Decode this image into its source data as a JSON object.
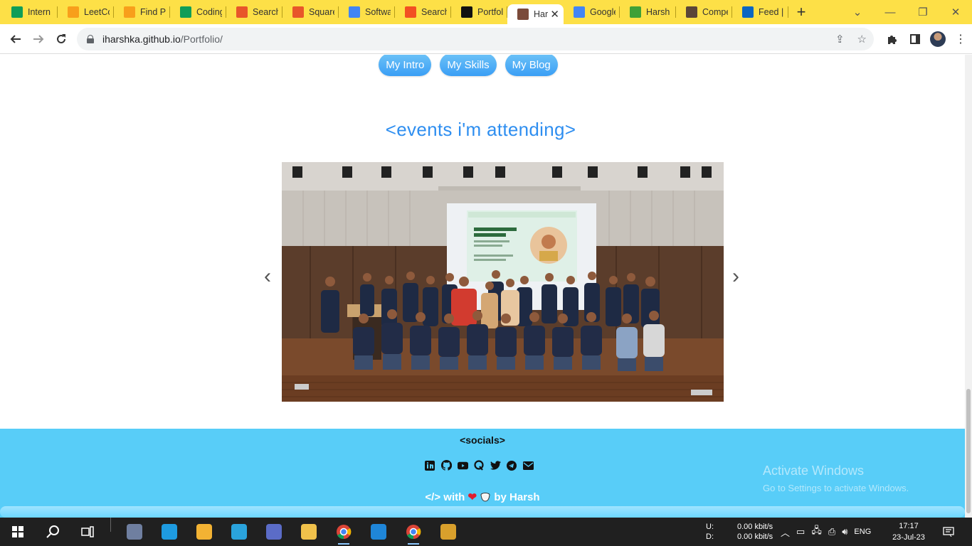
{
  "tabs": [
    {
      "title": "Intern",
      "icon": "sheets-icon",
      "color": "#0f9d58"
    },
    {
      "title": "LeetCo",
      "icon": "leetcode-icon",
      "color": "#f89f1b"
    },
    {
      "title": "Find Pi",
      "icon": "leetcode-icon",
      "color": "#f89f1b"
    },
    {
      "title": "Coding",
      "icon": "sheets-icon",
      "color": "#0f9d58"
    },
    {
      "title": "Search",
      "icon": "codechef-icon",
      "color": "#e8562a"
    },
    {
      "title": "Square",
      "icon": "codechef-icon",
      "color": "#e8562a"
    },
    {
      "title": "Softwa",
      "icon": "google-icon",
      "color": "#4285f4"
    },
    {
      "title": "Search",
      "icon": "microsoft-icon",
      "color": "#f25022"
    },
    {
      "title": "Portfol",
      "icon": "github-icon",
      "color": "#111111"
    },
    {
      "title": "Har",
      "icon": "profile-photo-icon",
      "color": "#7b4a3a"
    },
    {
      "title": "Google",
      "icon": "docs-icon",
      "color": "#4285f4"
    },
    {
      "title": "Harsh",
      "icon": "mongodb-leaf-icon",
      "color": "#3fa037"
    },
    {
      "title": "Compe",
      "icon": "cc-icon",
      "color": "#5b4638"
    },
    {
      "title": "Feed |",
      "icon": "linkedin-icon",
      "color": "#0a66c2"
    }
  ],
  "active_tab_index": 9,
  "address": {
    "host": "iharshka.github.io",
    "path": "/Portfolio/"
  },
  "nav": {
    "buttons": [
      "My Intro",
      "My Skills",
      "My Blog"
    ]
  },
  "events": {
    "heading": "<events i'm attending>",
    "prev_label": "‹",
    "next_label": "›"
  },
  "footer": {
    "socials_title": "<socials>",
    "social_icons": [
      "linkedin-icon",
      "github-icon",
      "youtube-icon",
      "quora-icon",
      "twitter-icon",
      "telegram-icon",
      "email-icon"
    ],
    "credit_prefix": "</> with",
    "credit_suffix": "by Harsh"
  },
  "watermark": {
    "line1": "Activate Windows",
    "line2": "Go to Settings to activate Windows."
  },
  "taskbar": {
    "apps": [
      "start-icon",
      "search-icon",
      "task-view-icon",
      "calculator-icon",
      "edge-icon",
      "store-icon",
      "telegram-icon",
      "app-grid-icon",
      "file-explorer-icon",
      "chrome-icon",
      "vscode-icon",
      "chrome-profile-icon",
      "git-icon"
    ],
    "net_labels": "U:\nD:",
    "net_up": "0.00 kbit/s",
    "net_down": "0.00 kbit/s",
    "lang": "ENG",
    "time": "17:17",
    "date": "23-Jul-23"
  },
  "colors": {
    "accent": "#2e8ef0",
    "footer": "#58cdf8",
    "tabbar": "#fde047"
  }
}
